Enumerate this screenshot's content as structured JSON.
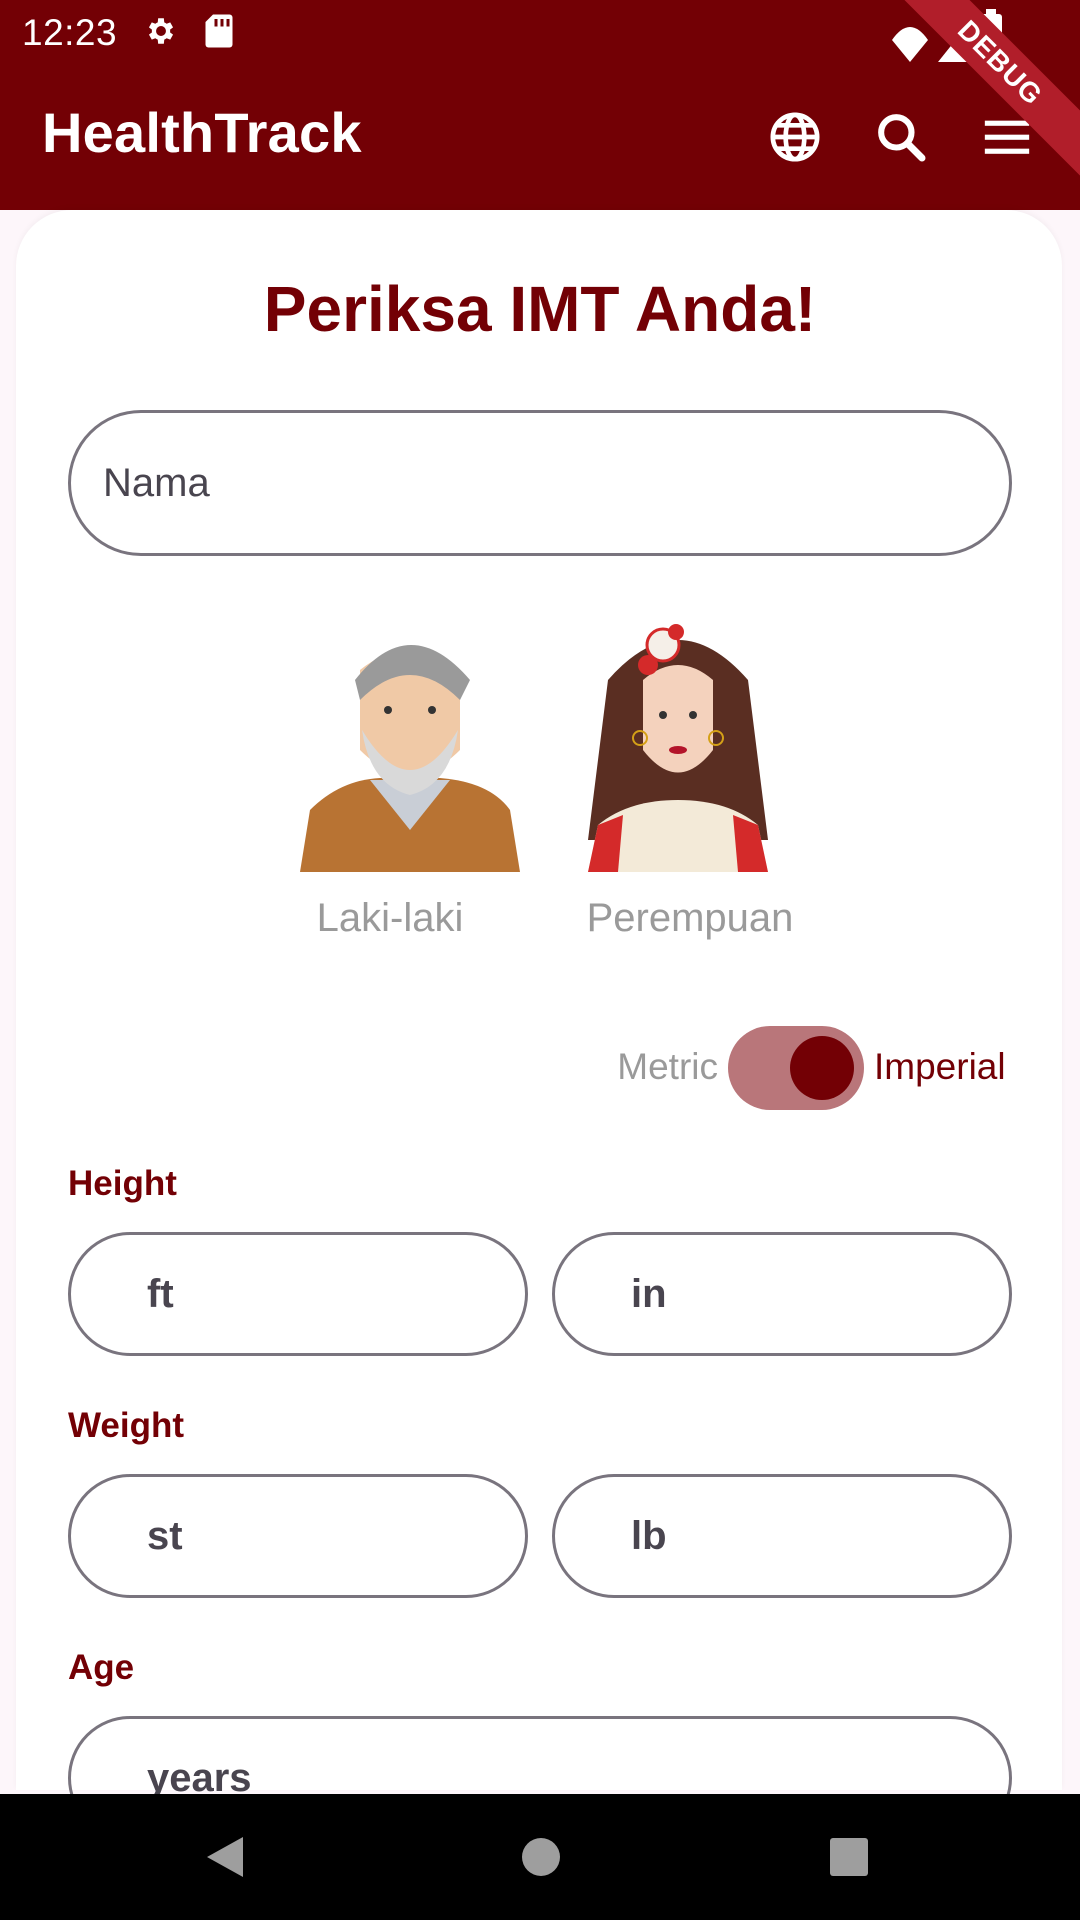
{
  "status_bar": {
    "time": "12:23",
    "icons": [
      "gear-icon",
      "sd-card-icon",
      "wifi-icon",
      "signal-icon",
      "battery-icon"
    ]
  },
  "app_bar": {
    "title": "HealthTrack",
    "actions": [
      "globe-icon",
      "search-icon",
      "menu-icon"
    ],
    "debug_banner": "DEBUG"
  },
  "form": {
    "heading": "Periksa IMT Anda!",
    "name_placeholder": "Nama",
    "gender": {
      "male_label": "Laki-laki",
      "female_label": "Perempuan"
    },
    "units": {
      "metric_label": "Metric",
      "imperial_label": "Imperial",
      "selected": "Imperial"
    },
    "height": {
      "label": "Height",
      "ft_placeholder": "ft",
      "in_placeholder": "in"
    },
    "weight": {
      "label": "Weight",
      "st_placeholder": "st",
      "lb_placeholder": "lb"
    },
    "age": {
      "label": "Age",
      "years_placeholder": "years"
    }
  },
  "colors": {
    "primary": "#730005",
    "toggle_track": "#b9767a",
    "muted_text": "#9a9a9a",
    "outline": "#79747e"
  },
  "nav_bar": {
    "buttons": [
      "back-icon",
      "home-icon",
      "recents-icon"
    ]
  }
}
